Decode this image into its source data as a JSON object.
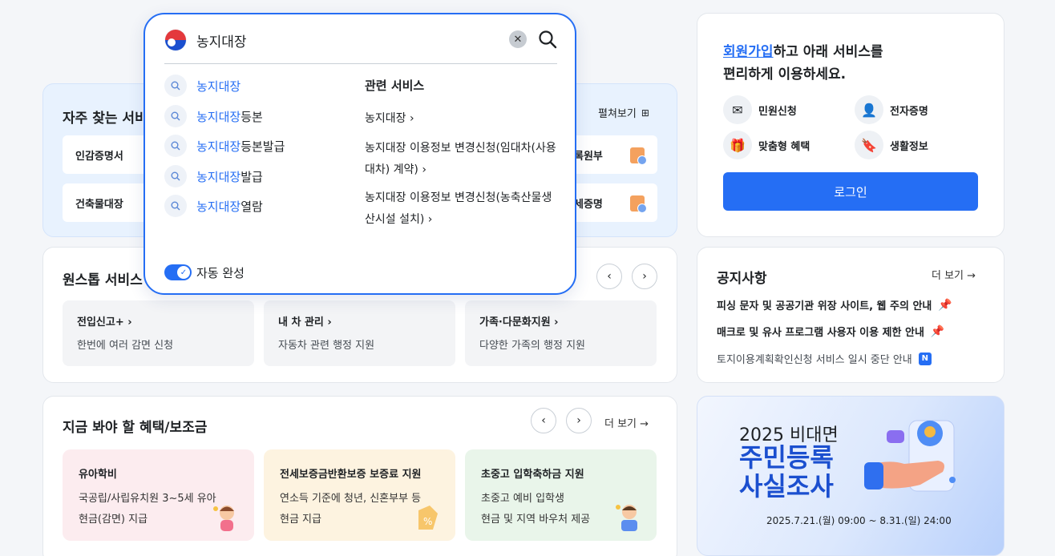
{
  "search": {
    "query": "농지대장",
    "highlight": "농지대장",
    "suggestions": [
      {
        "suffix": ""
      },
      {
        "suffix": "등본"
      },
      {
        "suffix": "등본발급"
      },
      {
        "suffix": "발급"
      },
      {
        "suffix": "열람"
      }
    ],
    "related_title": "관련 서비스",
    "related": [
      "농지대장 ›",
      "농지대장 이용정보 변경신청(임대차(사용대차) 계약) ›",
      "농지대장 이용정보 변경신청(농축산물생산시설 설치) ›"
    ],
    "autocomplete_label": "자동 완성"
  },
  "favorites": {
    "title": "자주 찾는 서비",
    "expand_label": "펼쳐보기",
    "items": [
      "인감증명서",
      "건축물대장",
      "록원부",
      "세증명"
    ]
  },
  "onestop": {
    "title": "원스톱 서비스",
    "cards": [
      {
        "title": "전입신고+ ›",
        "desc": "한번에 여러 감면 신청"
      },
      {
        "title": "내 차 관리 ›",
        "desc": "자동차 관련 행정 지원"
      },
      {
        "title": "가족·다문화지원 ›",
        "desc": "다양한 가족의 행정 지원"
      }
    ]
  },
  "benefits": {
    "title": "지금 봐야 할 혜택/보조금",
    "more_label": "더 보기 →",
    "cards": [
      {
        "title": "유아학비",
        "line1": "국공립/사립유치원 3~5세 유아",
        "line2": "현금(감면) 지급",
        "color": "#fcecef"
      },
      {
        "title": "전세보증금반환보증 보증료 지원",
        "line1": "연소득 기준에 청년, 신혼부부 등",
        "line2": "현금 지급",
        "color": "#fdf3e0"
      },
      {
        "title": "초중고 입학축하금 지원",
        "line1": "초중고 예비 입학생",
        "line2": "현금 및 지역 바우처 제공",
        "color": "#e9f5ea"
      }
    ]
  },
  "login_panel": {
    "signup_link": "회원가입",
    "headline_rest": "하고 아래 서비스를",
    "headline_line2": "편리하게 이용하세요.",
    "services": [
      "민원신청",
      "전자증명",
      "맞춤형 혜택",
      "생활정보"
    ],
    "login_label": "로그인"
  },
  "notices": {
    "title": "공지사항",
    "more_label": "더 보기 →",
    "items": [
      "피싱 문자 및 공공기관 위장 사이트, 웹 주의 안내",
      "매크로 및 유사 프로그램 사용자 이용 제한 안내",
      "토지이용계획확인신청 서비스 일시 중단 안내"
    ],
    "new_badge": "N"
  },
  "banner": {
    "line1": "2025 비대면",
    "line2": "주민등록",
    "line3": "사실조사",
    "period": "2025.7.21.(월) 09:00 ~ 8.31.(일) 24:00"
  },
  "colors": {
    "primary": "#256ef4",
    "text": "#1e2124",
    "banner_title": "#1b4fcf"
  }
}
